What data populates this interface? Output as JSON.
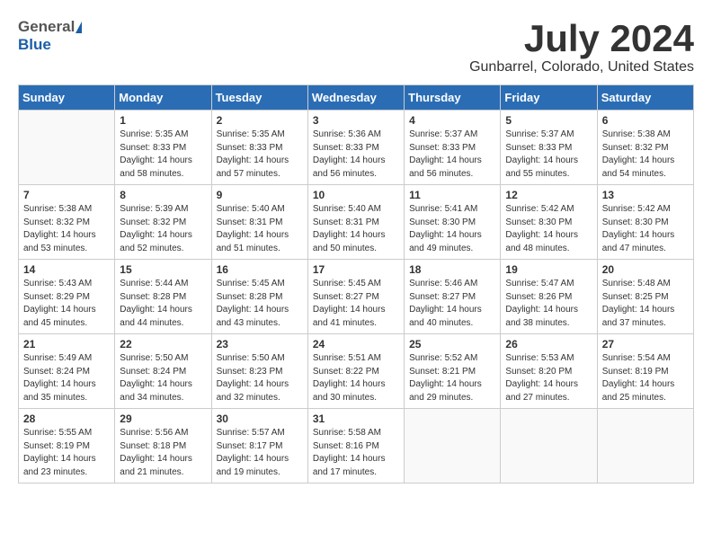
{
  "header": {
    "logo_general": "General",
    "logo_blue": "Blue",
    "month_year": "July 2024",
    "location": "Gunbarrel, Colorado, United States"
  },
  "calendar": {
    "days_of_week": [
      "Sunday",
      "Monday",
      "Tuesday",
      "Wednesday",
      "Thursday",
      "Friday",
      "Saturday"
    ],
    "weeks": [
      [
        {
          "day": "",
          "info": ""
        },
        {
          "day": "1",
          "info": "Sunrise: 5:35 AM\nSunset: 8:33 PM\nDaylight: 14 hours\nand 58 minutes."
        },
        {
          "day": "2",
          "info": "Sunrise: 5:35 AM\nSunset: 8:33 PM\nDaylight: 14 hours\nand 57 minutes."
        },
        {
          "day": "3",
          "info": "Sunrise: 5:36 AM\nSunset: 8:33 PM\nDaylight: 14 hours\nand 56 minutes."
        },
        {
          "day": "4",
          "info": "Sunrise: 5:37 AM\nSunset: 8:33 PM\nDaylight: 14 hours\nand 56 minutes."
        },
        {
          "day": "5",
          "info": "Sunrise: 5:37 AM\nSunset: 8:33 PM\nDaylight: 14 hours\nand 55 minutes."
        },
        {
          "day": "6",
          "info": "Sunrise: 5:38 AM\nSunset: 8:32 PM\nDaylight: 14 hours\nand 54 minutes."
        }
      ],
      [
        {
          "day": "7",
          "info": "Sunrise: 5:38 AM\nSunset: 8:32 PM\nDaylight: 14 hours\nand 53 minutes."
        },
        {
          "day": "8",
          "info": "Sunrise: 5:39 AM\nSunset: 8:32 PM\nDaylight: 14 hours\nand 52 minutes."
        },
        {
          "day": "9",
          "info": "Sunrise: 5:40 AM\nSunset: 8:31 PM\nDaylight: 14 hours\nand 51 minutes."
        },
        {
          "day": "10",
          "info": "Sunrise: 5:40 AM\nSunset: 8:31 PM\nDaylight: 14 hours\nand 50 minutes."
        },
        {
          "day": "11",
          "info": "Sunrise: 5:41 AM\nSunset: 8:30 PM\nDaylight: 14 hours\nand 49 minutes."
        },
        {
          "day": "12",
          "info": "Sunrise: 5:42 AM\nSunset: 8:30 PM\nDaylight: 14 hours\nand 48 minutes."
        },
        {
          "day": "13",
          "info": "Sunrise: 5:42 AM\nSunset: 8:30 PM\nDaylight: 14 hours\nand 47 minutes."
        }
      ],
      [
        {
          "day": "14",
          "info": "Sunrise: 5:43 AM\nSunset: 8:29 PM\nDaylight: 14 hours\nand 45 minutes."
        },
        {
          "day": "15",
          "info": "Sunrise: 5:44 AM\nSunset: 8:28 PM\nDaylight: 14 hours\nand 44 minutes."
        },
        {
          "day": "16",
          "info": "Sunrise: 5:45 AM\nSunset: 8:28 PM\nDaylight: 14 hours\nand 43 minutes."
        },
        {
          "day": "17",
          "info": "Sunrise: 5:45 AM\nSunset: 8:27 PM\nDaylight: 14 hours\nand 41 minutes."
        },
        {
          "day": "18",
          "info": "Sunrise: 5:46 AM\nSunset: 8:27 PM\nDaylight: 14 hours\nand 40 minutes."
        },
        {
          "day": "19",
          "info": "Sunrise: 5:47 AM\nSunset: 8:26 PM\nDaylight: 14 hours\nand 38 minutes."
        },
        {
          "day": "20",
          "info": "Sunrise: 5:48 AM\nSunset: 8:25 PM\nDaylight: 14 hours\nand 37 minutes."
        }
      ],
      [
        {
          "day": "21",
          "info": "Sunrise: 5:49 AM\nSunset: 8:24 PM\nDaylight: 14 hours\nand 35 minutes."
        },
        {
          "day": "22",
          "info": "Sunrise: 5:50 AM\nSunset: 8:24 PM\nDaylight: 14 hours\nand 34 minutes."
        },
        {
          "day": "23",
          "info": "Sunrise: 5:50 AM\nSunset: 8:23 PM\nDaylight: 14 hours\nand 32 minutes."
        },
        {
          "day": "24",
          "info": "Sunrise: 5:51 AM\nSunset: 8:22 PM\nDaylight: 14 hours\nand 30 minutes."
        },
        {
          "day": "25",
          "info": "Sunrise: 5:52 AM\nSunset: 8:21 PM\nDaylight: 14 hours\nand 29 minutes."
        },
        {
          "day": "26",
          "info": "Sunrise: 5:53 AM\nSunset: 8:20 PM\nDaylight: 14 hours\nand 27 minutes."
        },
        {
          "day": "27",
          "info": "Sunrise: 5:54 AM\nSunset: 8:19 PM\nDaylight: 14 hours\nand 25 minutes."
        }
      ],
      [
        {
          "day": "28",
          "info": "Sunrise: 5:55 AM\nSunset: 8:19 PM\nDaylight: 14 hours\nand 23 minutes."
        },
        {
          "day": "29",
          "info": "Sunrise: 5:56 AM\nSunset: 8:18 PM\nDaylight: 14 hours\nand 21 minutes."
        },
        {
          "day": "30",
          "info": "Sunrise: 5:57 AM\nSunset: 8:17 PM\nDaylight: 14 hours\nand 19 minutes."
        },
        {
          "day": "31",
          "info": "Sunrise: 5:58 AM\nSunset: 8:16 PM\nDaylight: 14 hours\nand 17 minutes."
        },
        {
          "day": "",
          "info": ""
        },
        {
          "day": "",
          "info": ""
        },
        {
          "day": "",
          "info": ""
        }
      ]
    ]
  }
}
